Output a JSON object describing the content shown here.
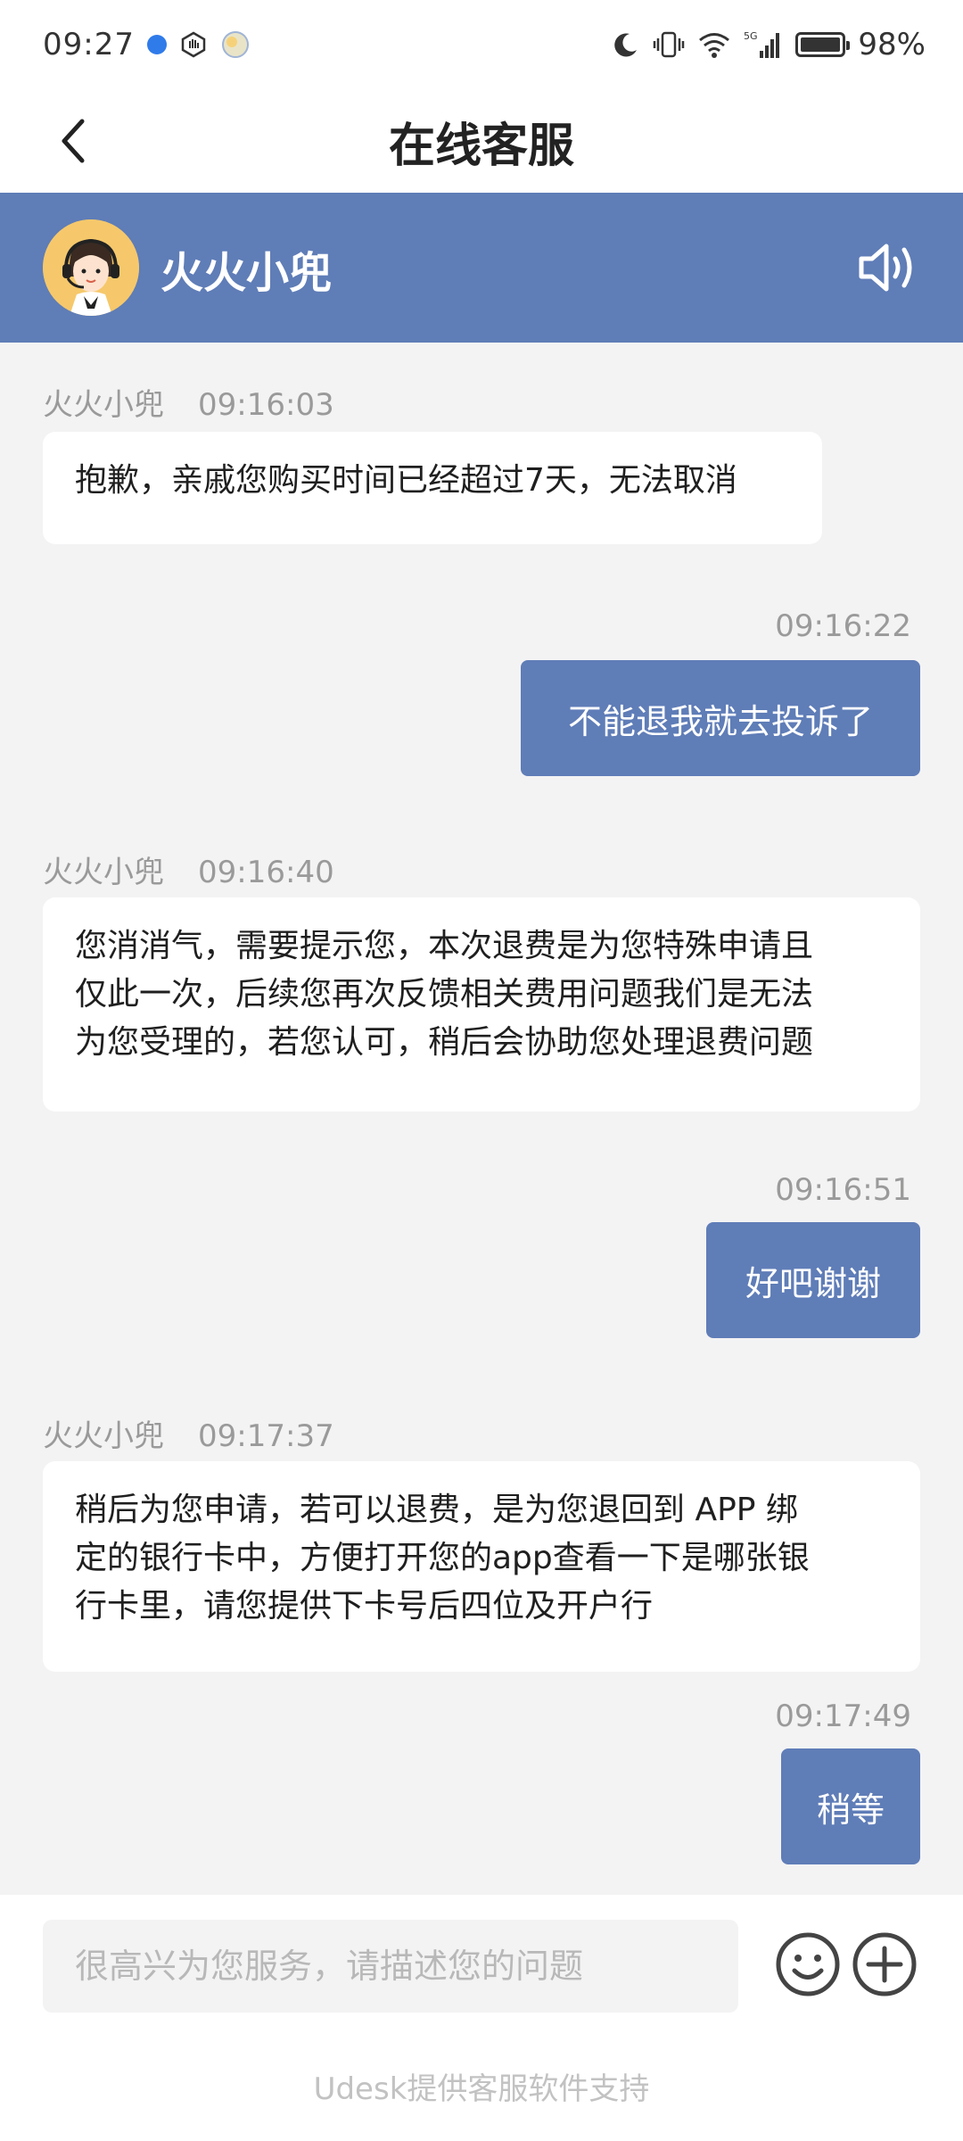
{
  "status_bar": {
    "time": "09:27",
    "battery": "98%",
    "network": "5G",
    "icons": [
      "location-dot-icon",
      "hand-icon",
      "weather-icon",
      "moon-icon",
      "vibrate-icon",
      "wifi-icon",
      "signal-icon",
      "battery-icon"
    ]
  },
  "header": {
    "title": "在线客服",
    "back_icon": "chevron-left-icon"
  },
  "agent": {
    "name": "火火小兜",
    "sound_icon": "speaker-icon",
    "accent_color": "#5f7db7"
  },
  "messages": [
    {
      "from": "agent",
      "sender": "火火小兜",
      "time": "09:16:03",
      "lines": [
        "抱歉，亲戚您购买时间已经超过7天，无法取消"
      ]
    },
    {
      "from": "user",
      "time": "09:16:22",
      "text": "不能退我就去投诉了"
    },
    {
      "from": "agent",
      "sender": "火火小兜",
      "time": "09:16:40",
      "lines": [
        "您消消气，需要提示您，本次退费是为您特殊申请且",
        "仅此一次，后续您再次反馈相关费用问题我们是无法",
        "为您受理的，若您认可，稍后会协助您处理退费问题"
      ]
    },
    {
      "from": "user",
      "time": "09:16:51",
      "text": "好吧谢谢"
    },
    {
      "from": "agent",
      "sender": "火火小兜",
      "time": "09:17:37",
      "lines": [
        "稍后为您申请，若可以退费，是为您退回到 APP 绑",
        "定的银行卡中，方便打开您的app查看一下是哪张银",
        "行卡里，请您提供下卡号后四位及开户行"
      ]
    },
    {
      "from": "user",
      "time": "09:17:49",
      "text": "稍等"
    }
  ],
  "input": {
    "placeholder": "很高兴为您服务，请描述您的问题",
    "value": ""
  },
  "footer": {
    "text": "Udesk提供客服软件支持"
  }
}
